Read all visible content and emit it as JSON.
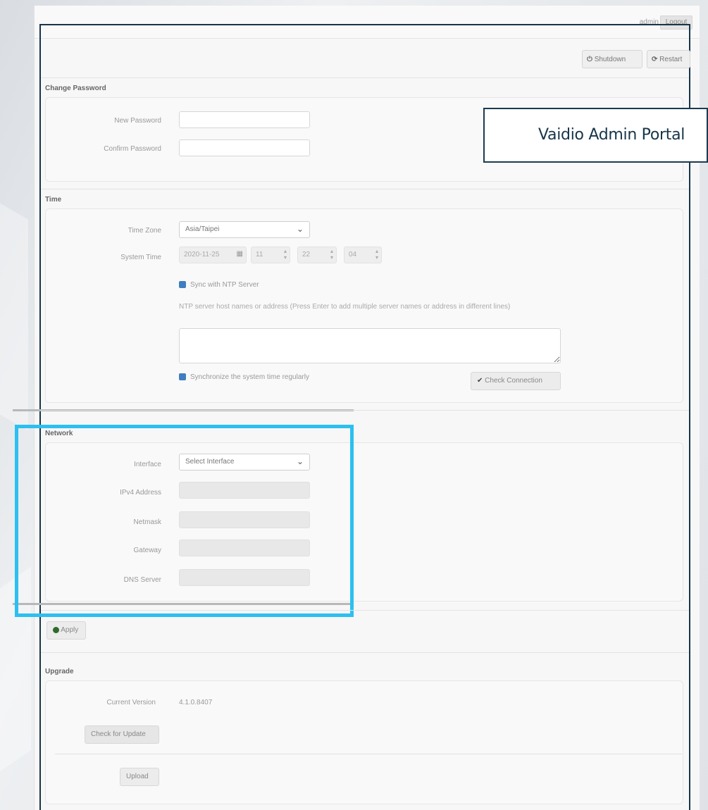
{
  "overlay": {
    "caption": "Vaidio Admin Portal"
  },
  "header": {
    "username": "admin",
    "logout_label": "Logout"
  },
  "toolbar": {
    "shutdown_label": "Shutdown",
    "restart_label": "Restart"
  },
  "sections": {
    "change_password": {
      "title": "Change Password",
      "new_password_label": "New Password",
      "confirm_password_label": "Confirm Password"
    },
    "time": {
      "title": "Time",
      "time_zone_label": "Time Zone",
      "time_zone_value": "Asia/Taipei",
      "system_time_label": "System Time",
      "date_value": "2020-11-25",
      "hour_value": "11",
      "minute_value": "22",
      "second_value": "04",
      "ntp_checkbox_label": "Sync with NTP Server",
      "ntp_help": "NTP server host names or address (Press Enter to add multiple server names or address in different lines)",
      "sync_regularly_label": "Synchronize the system time regularly",
      "check_connection_label": "Check Connection"
    },
    "network": {
      "title": "Network",
      "interface_label": "Interface",
      "interface_value": "Select Interface",
      "ipv4_label": "IPv4 Address",
      "netmask_label": "Netmask",
      "gateway_label": "Gateway",
      "dns_label": "DNS Server"
    },
    "apply_label": "Apply",
    "upgrade": {
      "title": "Upgrade",
      "current_version_label": "Current Version",
      "current_version_value": "4.1.0.8407",
      "check_update_label": "Check for Update",
      "upload_label": "Upload"
    }
  },
  "colors": {
    "accent": "#2cc0f0",
    "frame": "#173549",
    "checkbox": "#3f7fbf"
  },
  "icons": {
    "shutdown": "power-icon",
    "restart": "refresh-icon",
    "apply": "check-circle-icon",
    "check_connection": "checkmark-icon",
    "dropdown": "chevron-down-icon"
  }
}
